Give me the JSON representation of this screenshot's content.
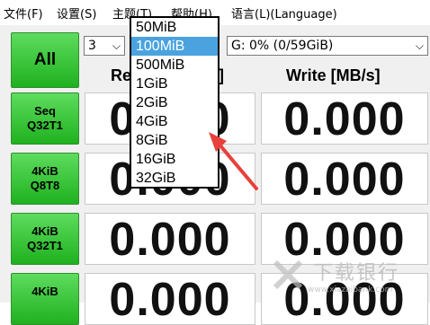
{
  "menu": {
    "file": "文件(F)",
    "settings": "设置(S)",
    "theme": "主题(T)",
    "help": "帮助(H)",
    "language": "语言(L)(Language)"
  },
  "controls": {
    "all_label": "All",
    "count_value": "3",
    "drive_value": "G: 0% (0/59GiB)"
  },
  "columns": {
    "read_visible": "Re",
    "read_unit_tail": "]",
    "write": "Write [MB/s]"
  },
  "tests": [
    {
      "line1": "Seq",
      "line2": "Q32T1",
      "read": "0.000",
      "write": "0.000"
    },
    {
      "line1": "4KiB",
      "line2": "Q8T8",
      "read": "0.000",
      "write": "0.000"
    },
    {
      "line1": "4KiB",
      "line2": "Q32T1",
      "read": "0.000",
      "write": "0.000"
    },
    {
      "line1": "4KiB",
      "line2": "",
      "read": "0.000",
      "write": "0.000"
    }
  ],
  "size_dropdown": {
    "options": [
      "50MiB",
      "100MiB",
      "500MiB",
      "1GiB",
      "2GiB",
      "4GiB",
      "8GiB",
      "16GiB",
      "32GiB"
    ],
    "selected": "100MiB"
  },
  "watermark": {
    "text": "下载银行",
    "url": "www.xiazaibank.com"
  },
  "colors": {
    "button_green": "#2fc32f",
    "highlight": "#4aa3df",
    "arrow": "#e8403a"
  }
}
